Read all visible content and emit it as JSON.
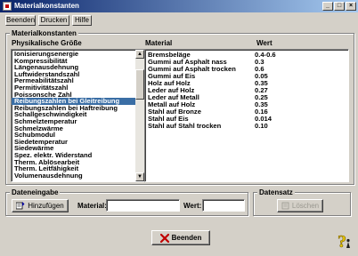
{
  "window": {
    "title": "Materialkonstanten",
    "buttons": {
      "minimize": "_",
      "maximize": "□",
      "close": "×"
    }
  },
  "menu": {
    "items": [
      {
        "label": "Beenden"
      },
      {
        "label": "Drucken"
      },
      {
        "label": "Hilfe"
      }
    ]
  },
  "materialkonstanten": {
    "group_title": "Materialkonstanten",
    "physik_header": "Physikalische Größe",
    "material_header": "Material",
    "wert_header": "Wert",
    "physik_items": [
      "Ionisierungsenergie",
      "Kompressibilität",
      "Längenausdehnung",
      "Luftwiderstandszahl",
      "Permeabilitätszahl",
      "Permitivitätszahl",
      "Poissonsche Zahl",
      "Reibungszahlen bei Gleitreibung",
      "Reibungszahlen bei Haftreibung",
      "Schallgeschwindigkeit",
      "Schmelztemperatur",
      "Schmelzwärme",
      "Schubmodul",
      "Siedetemperatur",
      "Siedewärme",
      "Spez. elektr. Widerstand",
      "Therm. Ablösearbeit",
      "Therm. Leitfähigkeit",
      "Volumenausdehnung"
    ],
    "selected_index": 7,
    "materials": [
      {
        "material": "Bremsbeläge",
        "wert": "0.4-0.6"
      },
      {
        "material": "Gummi auf Asphalt nass",
        "wert": "0.3"
      },
      {
        "material": "Gummi auf Asphalt trocken",
        "wert": "0.6"
      },
      {
        "material": "Gummi auf Eis",
        "wert": "0.05"
      },
      {
        "material": "Holz auf Holz",
        "wert": "0.35"
      },
      {
        "material": "Leder auf Holz",
        "wert": "0.27"
      },
      {
        "material": "Leder auf Metall",
        "wert": "0.25"
      },
      {
        "material": "Metall auf Holz",
        "wert": "0.35"
      },
      {
        "material": "Stahl auf Bronze",
        "wert": "0.16"
      },
      {
        "material": "Stahl auf Eis",
        "wert": "0.014"
      },
      {
        "material": "Stahl auf Stahl trocken",
        "wert": "0.10"
      }
    ]
  },
  "dateneingabe": {
    "group_title": "Dateneingabe",
    "add_button": "Hinzufügen",
    "material_label": "Material:",
    "material_value": "",
    "wert_label": "Wert:",
    "wert_value": ""
  },
  "datensatz": {
    "group_title": "Datensatz",
    "delete_button": "Löschen"
  },
  "footer": {
    "close_button": "Beenden"
  },
  "colors": {
    "selection": "#3a6ea5",
    "title_start": "#0a246a",
    "title_end": "#a6caf0",
    "face": "#d4d0c8"
  }
}
